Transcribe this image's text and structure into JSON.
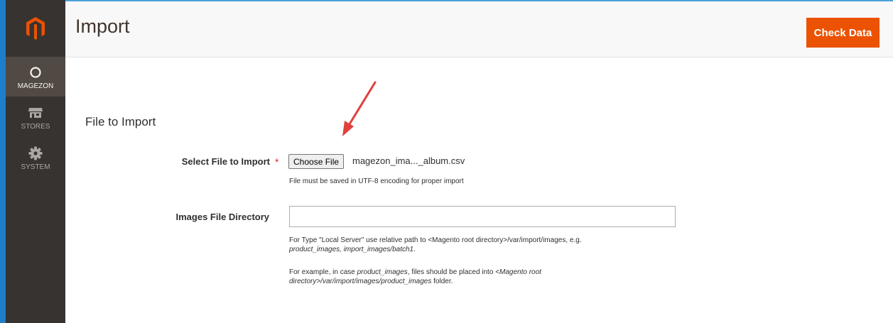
{
  "app": {
    "brand_color": "#eb5202",
    "sidebar_bg": "#373330"
  },
  "sidebar": {
    "logo_icon": "magento-logo-icon",
    "items": [
      {
        "label": "MAGEZON",
        "icon": "magezon-ring-icon",
        "active": true
      },
      {
        "label": "STORES",
        "icon": "store-icon",
        "active": false
      },
      {
        "label": "SYSTEM",
        "icon": "gear-icon",
        "active": false
      }
    ]
  },
  "header": {
    "title": "Import",
    "check_data_label": "Check Data"
  },
  "form": {
    "section_title": "File to Import",
    "select_file": {
      "label": "Select File to Import",
      "required_mark": "*",
      "button_label": "Choose File",
      "file_name": "magezon_ima..._album.csv",
      "note": "File must be saved in UTF-8 encoding for proper import"
    },
    "images_dir": {
      "label": "Images File Directory",
      "value": "",
      "note1_line1": "For Type \"Local Server\" use relative path to <Magento root directory>/var/import/images, e.g.",
      "note1_line2_em": "product_images, import_images/batch1",
      "note1_line2_tail": ".",
      "note2_line1_pre": "For example, in case ",
      "note2_line1_em1": "product_images",
      "note2_line1_mid": ", files should be placed into ",
      "note2_line1_em2": "<Magento root",
      "note2_line2_em": "directory>/var/import/images/product_images",
      "note2_line2_tail": " folder."
    }
  },
  "annotation": {
    "arrow_color": "#e0403c"
  }
}
